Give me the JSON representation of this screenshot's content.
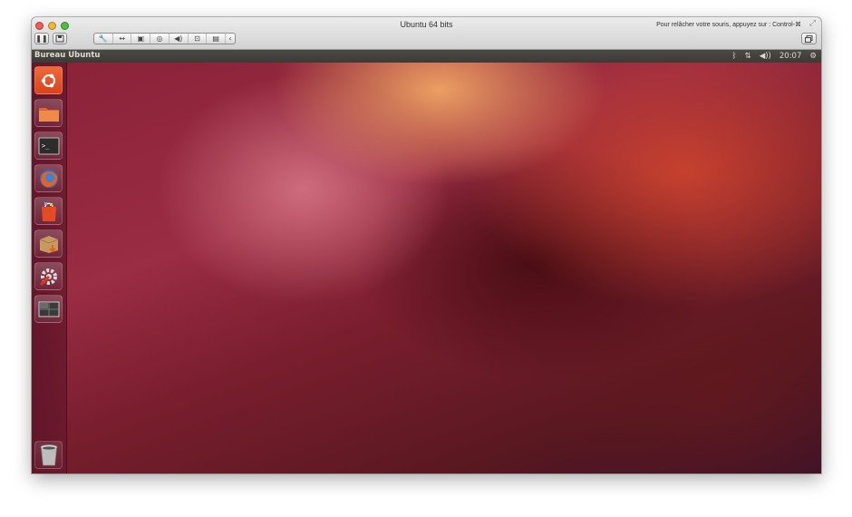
{
  "vm_window": {
    "title": "Ubuntu 64 bits",
    "release_hint": "Pour relâcher votre souris, appuyez sur : Control-⌘",
    "toolbar": {
      "pause_icon": "pause-icon",
      "snapshot_icon": "snapshot-icon",
      "settings_icon": "wrench-icon",
      "network_icon": "network-arrows-icon",
      "disk_icon": "disk-icon",
      "cdrom_icon": "cdrom-icon",
      "sound_icon": "speaker-icon",
      "usb_icon": "usb-icon",
      "display_icon": "display-icon",
      "more_icon": "chevron-left-icon",
      "unity_icon": "window-restore-icon"
    }
  },
  "panel": {
    "title": "Bureau Ubuntu",
    "indicators": {
      "bluetooth": "bluetooth-icon",
      "network": "network-transfer-icon",
      "sound": "volume-icon",
      "time": "20:07",
      "session": "gear-icon"
    }
  },
  "launcher": {
    "items": [
      {
        "name": "dash-home",
        "icon": "ubuntu-logo-icon"
      },
      {
        "name": "files",
        "icon": "folder-icon"
      },
      {
        "name": "terminal",
        "icon": "terminal-icon"
      },
      {
        "name": "firefox",
        "icon": "firefox-icon"
      },
      {
        "name": "software-center",
        "icon": "shopping-bag-icon"
      },
      {
        "name": "update-manager",
        "icon": "package-icon"
      },
      {
        "name": "system-settings",
        "icon": "settings-tools-icon"
      },
      {
        "name": "workspace-switcher",
        "icon": "workspace-icon"
      },
      {
        "name": "trash",
        "icon": "trash-icon"
      }
    ]
  },
  "colors": {
    "panel_bg": "#3f3d38",
    "launcher_bg": "#5f1428",
    "wallpaper_primary": "#8a2238",
    "wallpaper_highlight": "#f0a564"
  }
}
